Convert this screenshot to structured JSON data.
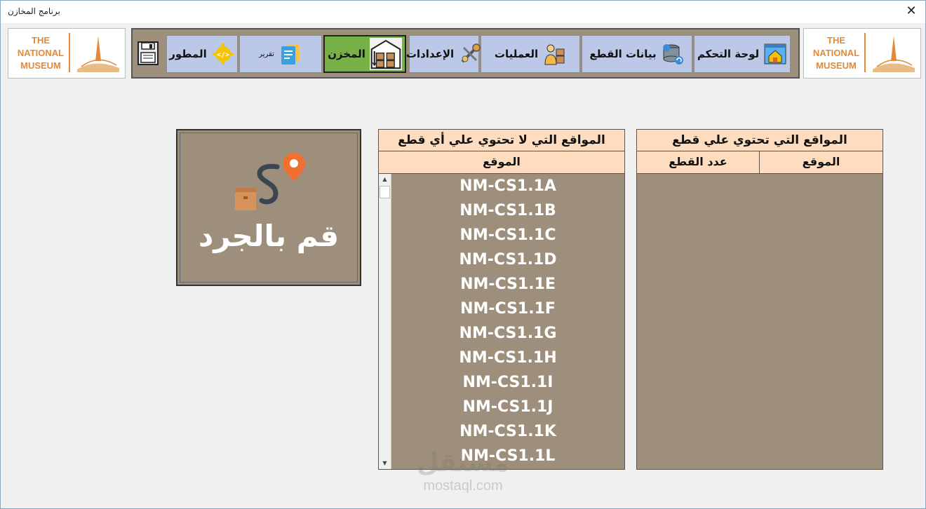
{
  "window": {
    "title": "برنامج المخازن",
    "close_label": "✕"
  },
  "logo": {
    "lines": [
      "THE",
      "NATIONAL",
      "MUSEUM"
    ]
  },
  "toolbar": {
    "items": [
      {
        "label": "لوحة التحكم",
        "icon": "home-window-icon",
        "active": false
      },
      {
        "label": "بيانات القطع",
        "icon": "database-sync-icon",
        "active": false
      },
      {
        "label": "العمليات",
        "icon": "worker-boxes-icon",
        "active": false
      },
      {
        "label": "الإعدادات",
        "icon": "tools-icon",
        "active": false
      },
      {
        "label": "المخزن",
        "icon": "warehouse-icon",
        "active": true
      },
      {
        "label": "تقرير",
        "icon": "report-icon",
        "active": false
      },
      {
        "label": "المطور",
        "icon": "code-gear-icon",
        "active": false
      }
    ],
    "save_icon": "floppy-disk-icon"
  },
  "inventory": {
    "label": "قم بالجرد",
    "icon": "route-pin-box-icon"
  },
  "empty_locations": {
    "title": "المواقع التي لا تحتوي علي أي قطع",
    "column": "الموقع",
    "items": [
      "NM-CS1.1A",
      "NM-CS1.1B",
      "NM-CS1.1C",
      "NM-CS1.1D",
      "NM-CS1.1E",
      "NM-CS1.1F",
      "NM-CS1.1G",
      "NM-CS1.1H",
      "NM-CS1.1I",
      "NM-CS1.1J",
      "NM-CS1.1K",
      "NM-CS1.1L"
    ]
  },
  "filled_locations": {
    "title": "المواقع التي تحتوي علي قطع",
    "columns": [
      "الموقع",
      "عدد القطع"
    ],
    "items": []
  },
  "watermark": {
    "arabic": "مستقل",
    "latin": "mostaql.com"
  },
  "colors": {
    "panel": "#9d8f7b",
    "header": "#fddcbf",
    "button": "#bcc8e8",
    "active": "#78b048",
    "brand": "#e08a3a"
  }
}
